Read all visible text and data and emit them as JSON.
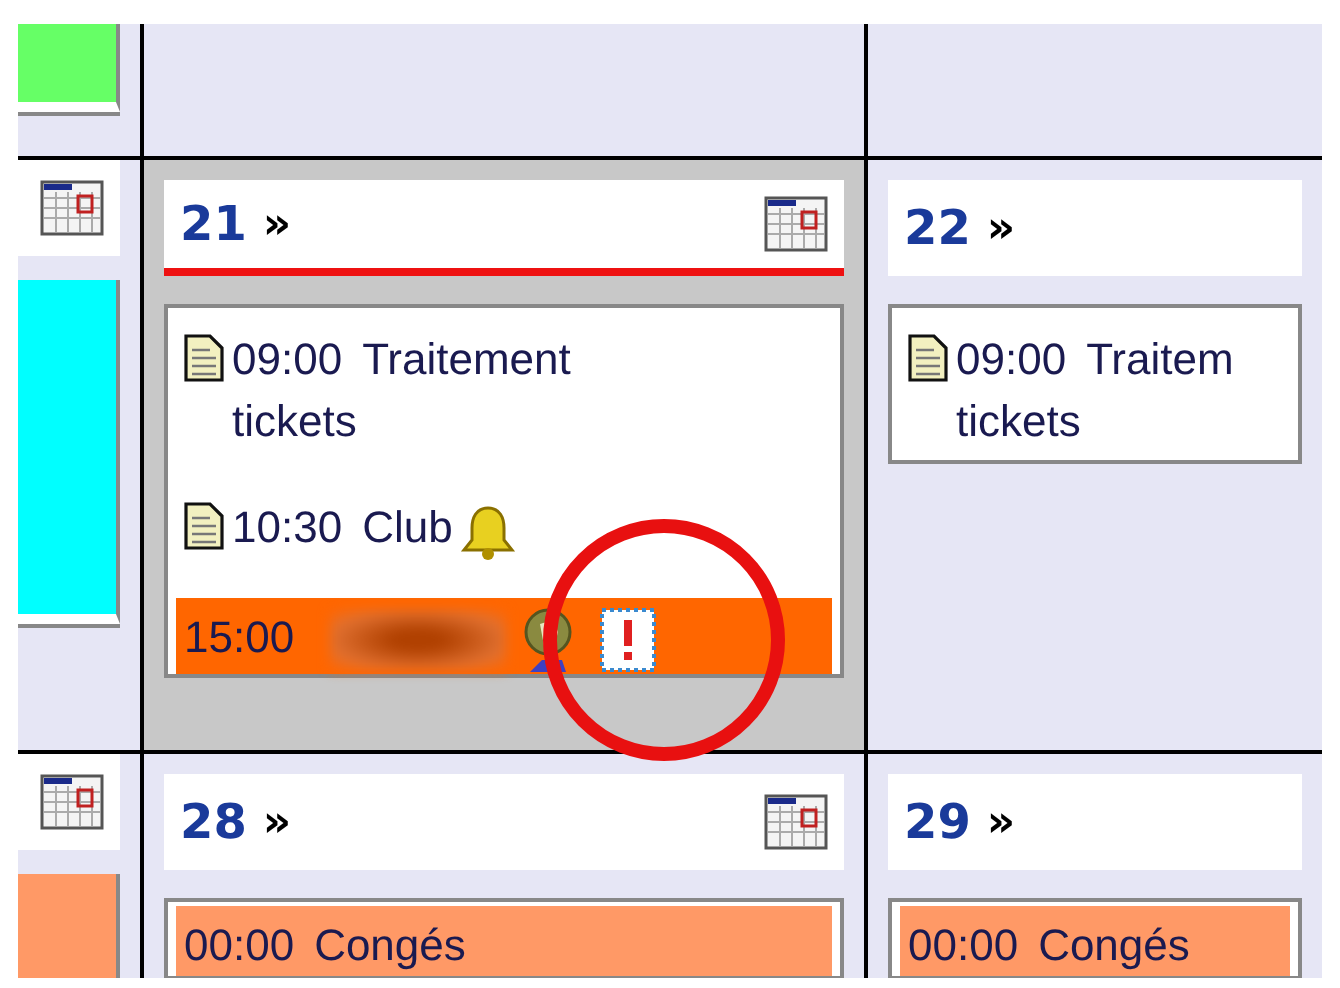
{
  "weeks": [
    {
      "days": [
        {
          "events": [
            {
              "color": "#66ff66"
            }
          ]
        }
      ]
    },
    {
      "days": [
        {
          "add_icon": true,
          "events": [
            {
              "color": "#00ffff"
            }
          ]
        },
        {
          "number": "21",
          "arrow": "»",
          "today": true,
          "add_icon": true,
          "events": [
            {
              "time": "09:00",
              "title": "Traitement tickets",
              "note": true,
              "color": "#ffffff"
            },
            {
              "time": "10:30",
              "title": "Club",
              "note": true,
              "reminder": true,
              "color": "#ffffff"
            },
            {
              "time": "15:00",
              "redacted": true,
              "participants": true,
              "important": true,
              "color": "#ff6600"
            }
          ]
        },
        {
          "number": "22",
          "arrow": "»",
          "today": false,
          "add_icon": false,
          "events": [
            {
              "time": "09:00",
              "title": "Traitem tickets",
              "note": true,
              "color": "#ffffff"
            }
          ]
        }
      ]
    },
    {
      "days": [
        {
          "add_icon": true,
          "events": [
            {
              "color": "#ff9966"
            }
          ]
        },
        {
          "number": "28",
          "arrow": "»",
          "today": false,
          "add_icon": true,
          "events": [
            {
              "time": "00:00",
              "title": "Congés",
              "color": "#ff9966"
            }
          ]
        },
        {
          "number": "29",
          "arrow": "»",
          "today": false,
          "add_icon": false,
          "events": [
            {
              "time": "00:00",
              "title": "Congés",
              "color": "#ff9966"
            }
          ]
        }
      ]
    }
  ],
  "highlight": {
    "kind": "circle"
  }
}
